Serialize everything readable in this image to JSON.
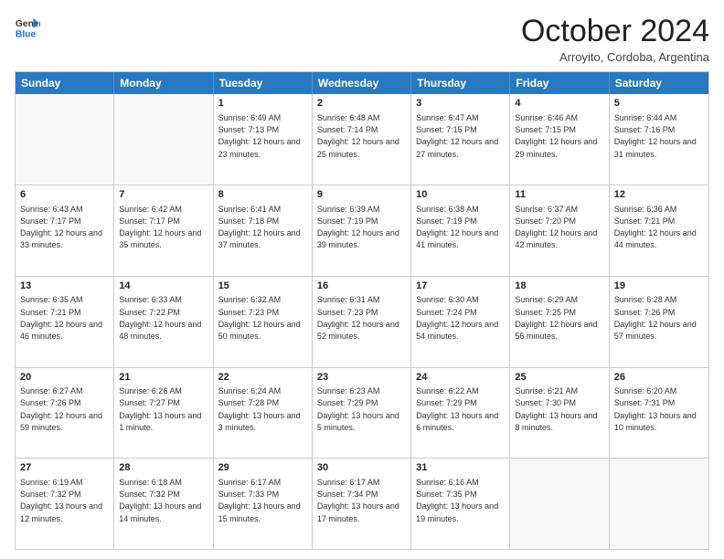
{
  "header": {
    "logo_line1": "General",
    "logo_line2": "Blue",
    "month_title": "October 2024",
    "location": "Arroyito, Cordoba, Argentina"
  },
  "weekdays": [
    "Sunday",
    "Monday",
    "Tuesday",
    "Wednesday",
    "Thursday",
    "Friday",
    "Saturday"
  ],
  "rows": [
    [
      {
        "day": "",
        "text": ""
      },
      {
        "day": "",
        "text": ""
      },
      {
        "day": "1",
        "text": "Sunrise: 6:49 AM\nSunset: 7:13 PM\nDaylight: 12 hours and 23 minutes."
      },
      {
        "day": "2",
        "text": "Sunrise: 6:48 AM\nSunset: 7:14 PM\nDaylight: 12 hours and 25 minutes."
      },
      {
        "day": "3",
        "text": "Sunrise: 6:47 AM\nSunset: 7:15 PM\nDaylight: 12 hours and 27 minutes."
      },
      {
        "day": "4",
        "text": "Sunrise: 6:46 AM\nSunset: 7:15 PM\nDaylight: 12 hours and 29 minutes."
      },
      {
        "day": "5",
        "text": "Sunrise: 6:44 AM\nSunset: 7:16 PM\nDaylight: 12 hours and 31 minutes."
      }
    ],
    [
      {
        "day": "6",
        "text": "Sunrise: 6:43 AM\nSunset: 7:17 PM\nDaylight: 12 hours and 33 minutes."
      },
      {
        "day": "7",
        "text": "Sunrise: 6:42 AM\nSunset: 7:17 PM\nDaylight: 12 hours and 35 minutes."
      },
      {
        "day": "8",
        "text": "Sunrise: 6:41 AM\nSunset: 7:18 PM\nDaylight: 12 hours and 37 minutes."
      },
      {
        "day": "9",
        "text": "Sunrise: 6:39 AM\nSunset: 7:19 PM\nDaylight: 12 hours and 39 minutes."
      },
      {
        "day": "10",
        "text": "Sunrise: 6:38 AM\nSunset: 7:19 PM\nDaylight: 12 hours and 41 minutes."
      },
      {
        "day": "11",
        "text": "Sunrise: 6:37 AM\nSunset: 7:20 PM\nDaylight: 12 hours and 42 minutes."
      },
      {
        "day": "12",
        "text": "Sunrise: 6:36 AM\nSunset: 7:21 PM\nDaylight: 12 hours and 44 minutes."
      }
    ],
    [
      {
        "day": "13",
        "text": "Sunrise: 6:35 AM\nSunset: 7:21 PM\nDaylight: 12 hours and 46 minutes."
      },
      {
        "day": "14",
        "text": "Sunrise: 6:33 AM\nSunset: 7:22 PM\nDaylight: 12 hours and 48 minutes."
      },
      {
        "day": "15",
        "text": "Sunrise: 6:32 AM\nSunset: 7:23 PM\nDaylight: 12 hours and 50 minutes."
      },
      {
        "day": "16",
        "text": "Sunrise: 6:31 AM\nSunset: 7:23 PM\nDaylight: 12 hours and 52 minutes."
      },
      {
        "day": "17",
        "text": "Sunrise: 6:30 AM\nSunset: 7:24 PM\nDaylight: 12 hours and 54 minutes."
      },
      {
        "day": "18",
        "text": "Sunrise: 6:29 AM\nSunset: 7:25 PM\nDaylight: 12 hours and 56 minutes."
      },
      {
        "day": "19",
        "text": "Sunrise: 6:28 AM\nSunset: 7:26 PM\nDaylight: 12 hours and 57 minutes."
      }
    ],
    [
      {
        "day": "20",
        "text": "Sunrise: 6:27 AM\nSunset: 7:26 PM\nDaylight: 12 hours and 59 minutes."
      },
      {
        "day": "21",
        "text": "Sunrise: 6:26 AM\nSunset: 7:27 PM\nDaylight: 13 hours and 1 minute."
      },
      {
        "day": "22",
        "text": "Sunrise: 6:24 AM\nSunset: 7:28 PM\nDaylight: 13 hours and 3 minutes."
      },
      {
        "day": "23",
        "text": "Sunrise: 6:23 AM\nSunset: 7:29 PM\nDaylight: 13 hours and 5 minutes."
      },
      {
        "day": "24",
        "text": "Sunrise: 6:22 AM\nSunset: 7:29 PM\nDaylight: 13 hours and 6 minutes."
      },
      {
        "day": "25",
        "text": "Sunrise: 6:21 AM\nSunset: 7:30 PM\nDaylight: 13 hours and 8 minutes."
      },
      {
        "day": "26",
        "text": "Sunrise: 6:20 AM\nSunset: 7:31 PM\nDaylight: 13 hours and 10 minutes."
      }
    ],
    [
      {
        "day": "27",
        "text": "Sunrise: 6:19 AM\nSunset: 7:32 PM\nDaylight: 13 hours and 12 minutes."
      },
      {
        "day": "28",
        "text": "Sunrise: 6:18 AM\nSunset: 7:32 PM\nDaylight: 13 hours and 14 minutes."
      },
      {
        "day": "29",
        "text": "Sunrise: 6:17 AM\nSunset: 7:33 PM\nDaylight: 13 hours and 15 minutes."
      },
      {
        "day": "30",
        "text": "Sunrise: 6:17 AM\nSunset: 7:34 PM\nDaylight: 13 hours and 17 minutes."
      },
      {
        "day": "31",
        "text": "Sunrise: 6:16 AM\nSunset: 7:35 PM\nDaylight: 13 hours and 19 minutes."
      },
      {
        "day": "",
        "text": ""
      },
      {
        "day": "",
        "text": ""
      }
    ]
  ]
}
